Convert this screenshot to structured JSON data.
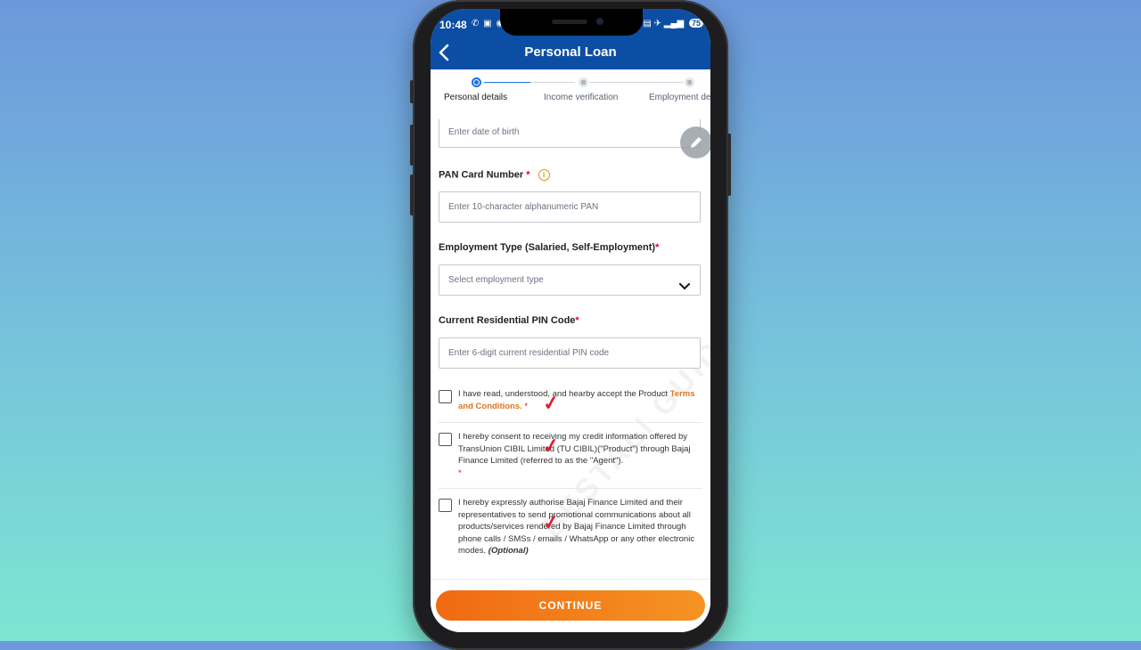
{
  "status": {
    "time": "10:48",
    "left_icons": "✆ ▣ ◉",
    "right_icons": "▤ ✈ ▂▄▆",
    "battery": "75"
  },
  "header": {
    "title": "Personal Loan"
  },
  "stepper": {
    "steps": [
      {
        "label": "Personal details"
      },
      {
        "label": "Income verification"
      },
      {
        "label": "Employment de"
      }
    ]
  },
  "form": {
    "dob": {
      "placeholder": "Enter date of birth"
    },
    "pan": {
      "label": "PAN Card Number",
      "required": "*",
      "placeholder": "Enter 10-character alphanumeric PAN"
    },
    "employment": {
      "label": "Employment Type (Salaried, Self-Employment)",
      "required": "*",
      "placeholder": "Select employment type"
    },
    "pincode": {
      "label": "Current Residential PIN Code",
      "required": "*",
      "placeholder": "Enter 6-digit current residential PIN code"
    }
  },
  "consents": [
    {
      "text": "I have read, understood, and hearby accept the Product ",
      "link": "Terms and Conditions.",
      "suffix": " *"
    },
    {
      "text": "I hereby consent to receiving my credit information offered by TransUnion CIBIL Limited (TU CIBIL)(\"Product\") through Bajaj Finance Limited (referred to as the \"Agent\").",
      "suffix": "*"
    },
    {
      "text": "I hereby expressly authorise Bajaj Finance Limited and their representatives to send promotional communications about all products/services rendered by Bajaj Finance Limited through phone calls / SMSs / emails / WhatsApp or any other electronic modes. ",
      "optional": "(Optional)"
    }
  ],
  "icons": {
    "back": "chevron-left-icon",
    "edit": "pencil-icon",
    "info": "info-icon",
    "dropdown": "chevron-down-icon",
    "tick": "check-mark-icon"
  },
  "footer": {
    "continue_label": "CONTINUE"
  },
  "colors": {
    "brand_blue": "#0c4ea3",
    "accent_orange": "#f06a12",
    "required_red": "#d0102b",
    "tick_red": "#e21b2c"
  }
}
